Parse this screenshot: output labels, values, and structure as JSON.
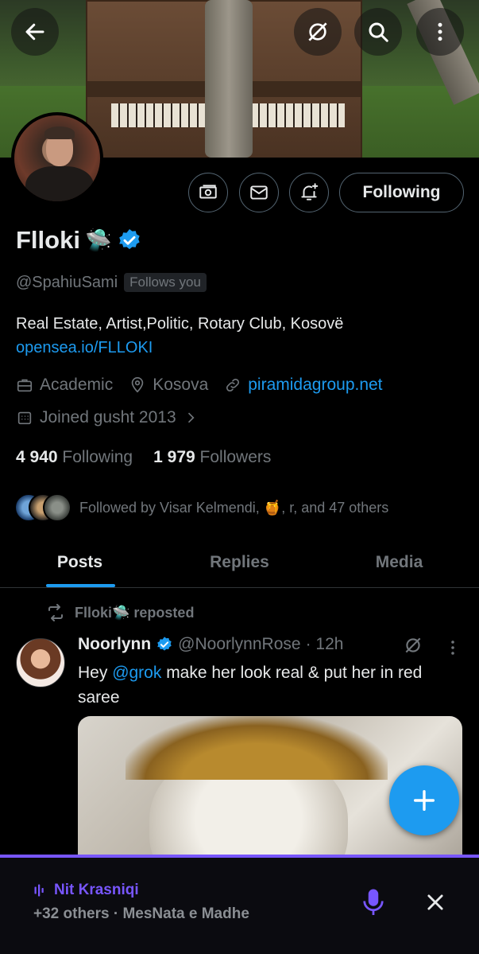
{
  "header": {
    "back_icon": "arrow-left-icon",
    "grok_icon": "grok-icon",
    "search_icon": "search-icon",
    "more_icon": "more-vertical-icon"
  },
  "profile": {
    "name": "Flloki",
    "name_emoji": "🛸",
    "handle": "@SpahiuSami",
    "follows_you": "Follows you",
    "bio": "Real Estate, Artist,Politic, Rotary Club, Kosovë",
    "bio_link": "opensea.io/FLLOKI",
    "category": "Academic",
    "location": "Kosova",
    "website": "piramidagroup.net",
    "joined": "Joined gusht 2013",
    "following_count": "4 940",
    "following_label": "Following",
    "followers_count": "1 979",
    "followers_label": "Followers",
    "followed_by": "Followed by Visar Kelmendi, 🍯, r, and 47 others",
    "follow_button": "Following"
  },
  "tabs": [
    {
      "label": "Posts",
      "active": true
    },
    {
      "label": "Replies",
      "active": false
    },
    {
      "label": "Media",
      "active": false
    }
  ],
  "post": {
    "repost_label": "Flloki🛸 reposted",
    "author_name": "Noorlynn",
    "author_handle": "@NoorlynnRose",
    "time": "· 12h",
    "text_before": "Hey ",
    "mention": "@grok",
    "text_after": " make her look real & put her in red saree"
  },
  "space": {
    "host": "Nit Krasniqi",
    "subtitle": "+32 others · MesNata e Madhe"
  },
  "colors": {
    "accent": "#1d9bf0",
    "space": "#7856ff",
    "muted": "#71767b"
  }
}
